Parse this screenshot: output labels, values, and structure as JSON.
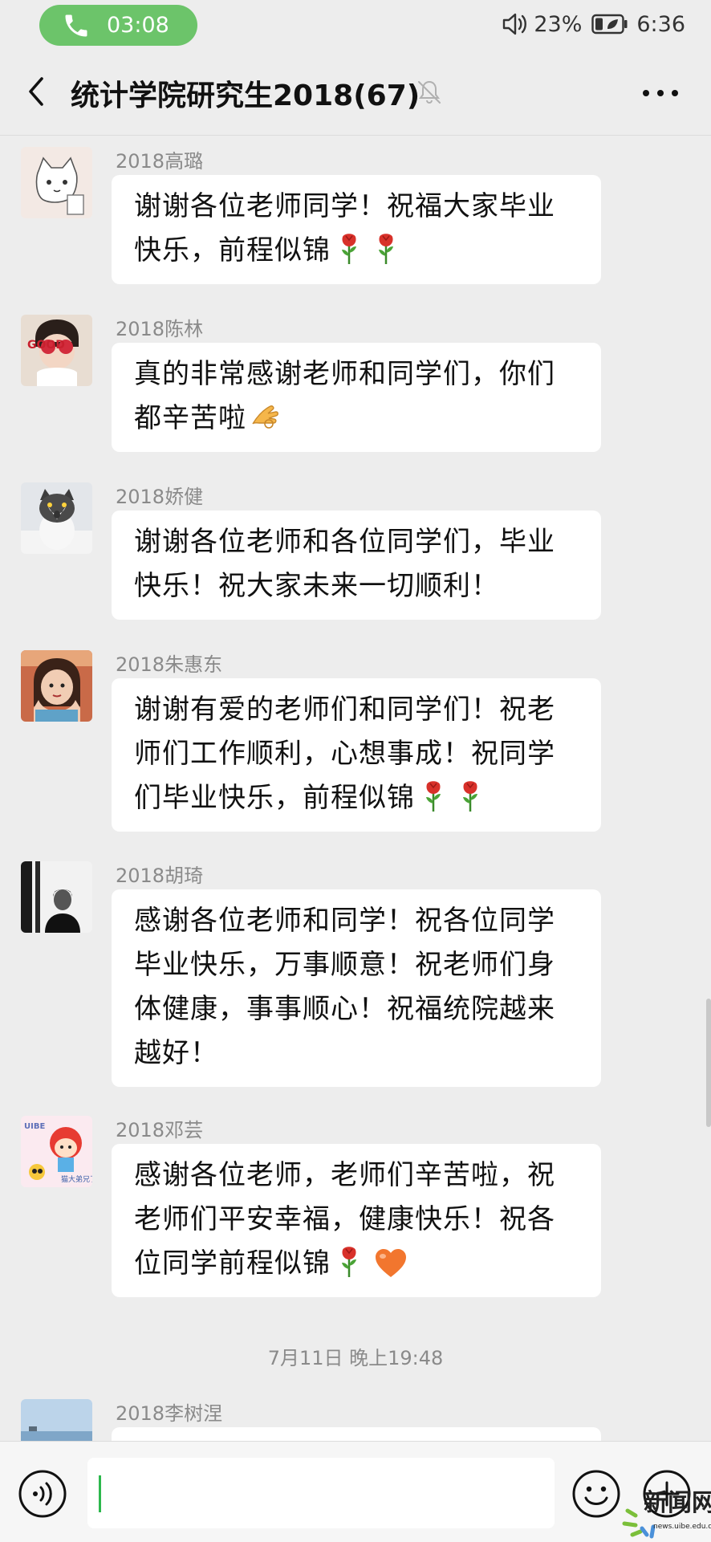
{
  "status_bar": {
    "call_timer": "03:08",
    "battery": "23%",
    "clock": "6:36"
  },
  "header": {
    "title": "统计学院研究生2018(67)",
    "icons": [
      "back-arrow-icon",
      "mute-bell-icon",
      "more-dots-icon"
    ]
  },
  "messages": [
    {
      "sender": "2018高璐",
      "text": "谢谢各位老师同学！祝福大家毕业快乐，前程似锦",
      "emoji": [
        "rose",
        "rose"
      ]
    },
    {
      "sender": "2018陈林",
      "text": "真的非常感谢老师和同学们，你们都辛苦啦",
      "emoji": [
        "hand"
      ]
    },
    {
      "sender": "2018娇健",
      "text": "谢谢各位老师和各位同学们，毕业快乐！祝大家未来一切顺利！",
      "emoji": []
    },
    {
      "sender": "2018朱惠东",
      "text": "谢谢有爱的老师们和同学们！祝老师们工作顺利，心想事成！祝同学们毕业快乐，前程似锦",
      "emoji": [
        "rose",
        "rose"
      ]
    },
    {
      "sender": "2018胡琦",
      "text": "感谢各位老师和同学！祝各位同学毕业快乐，万事顺意！祝老师们身体健康，事事顺心！祝福统院越来越好！",
      "emoji": []
    },
    {
      "sender": "2018邓芸",
      "text": "感谢各位老师，老师们辛苦啦，祝老师们平安幸福，健康快乐！祝各位同学前程似锦",
      "emoji": [
        "rose",
        "heart"
      ]
    }
  ],
  "time_divider": "7月11日 晚上19:48",
  "last_message": {
    "sender": "2018李树涅"
  },
  "avatar_texts": {
    "a2": "GOOD",
    "a6": "UIBE",
    "a6b": "猫大弟兄了"
  },
  "watermark": {
    "text": "新闻网",
    "url": "news.uibe.edu.cn"
  },
  "colors": {
    "call_pill": "#6cc46a",
    "background": "#ededed",
    "bubble": "#ffffff",
    "cursor": "#2db84d"
  }
}
